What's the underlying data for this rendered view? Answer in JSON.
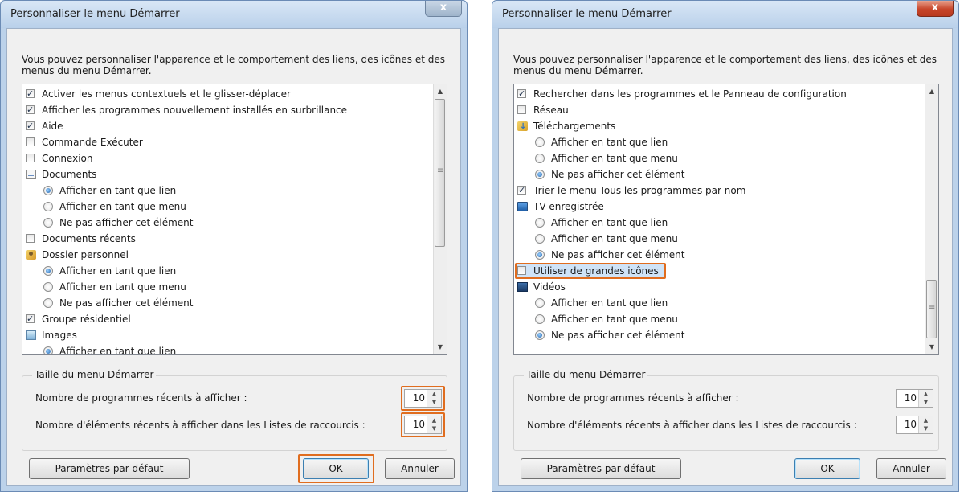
{
  "dialog_left": {
    "title": "Personnaliser le menu Démarrer",
    "close_glyph": "x",
    "description": "Vous pouvez personnaliser l'apparence et le comportement des liens, des icônes et des menus du menu Démarrer.",
    "items": [
      {
        "type": "checkbox",
        "checked": true,
        "label": "Activer les menus contextuels et le glisser-déplacer"
      },
      {
        "type": "checkbox",
        "checked": true,
        "label": "Afficher les programmes nouvellement installés en surbrillance"
      },
      {
        "type": "checkbox",
        "checked": true,
        "label": "Aide"
      },
      {
        "type": "checkbox",
        "checked": false,
        "label": "Commande Exécuter"
      },
      {
        "type": "checkbox",
        "checked": false,
        "label": "Connexion"
      },
      {
        "type": "folder",
        "icon": "document-icon",
        "label": "Documents"
      },
      {
        "type": "radio",
        "checked": true,
        "label": "Afficher en tant que lien"
      },
      {
        "type": "radio",
        "checked": false,
        "label": "Afficher en tant que menu"
      },
      {
        "type": "radio",
        "checked": false,
        "label": "Ne pas afficher cet élément"
      },
      {
        "type": "checkbox",
        "checked": false,
        "label": "Documents récents"
      },
      {
        "type": "folder",
        "icon": "user-folder-icon",
        "label": "Dossier personnel"
      },
      {
        "type": "radio",
        "checked": true,
        "label": "Afficher en tant que lien"
      },
      {
        "type": "radio",
        "checked": false,
        "label": "Afficher en tant que menu"
      },
      {
        "type": "radio",
        "checked": false,
        "label": "Ne pas afficher cet élément"
      },
      {
        "type": "checkbox",
        "checked": true,
        "label": "Groupe résidentiel"
      },
      {
        "type": "folder",
        "icon": "pictures-icon",
        "label": "Images"
      },
      {
        "type": "radio",
        "checked": true,
        "label": "Afficher en tant que lien"
      }
    ],
    "group_title": "Taille du menu Démarrer",
    "recent_programs_label": "Nombre de programmes récents à afficher :",
    "recent_programs_value": "10",
    "jumplist_label": "Nombre d'éléments récents à afficher dans les Listes de raccourcis :",
    "jumplist_value": "10",
    "defaults_button": "Paramètres par défaut",
    "ok_button": "OK",
    "cancel_button": "Annuler"
  },
  "dialog_right": {
    "title": "Personnaliser le menu Démarrer",
    "close_glyph": "x",
    "description": "Vous pouvez personnaliser l'apparence et le comportement des liens, des icônes et des menus du menu Démarrer.",
    "items": [
      {
        "type": "checkbox",
        "checked": true,
        "label": "Rechercher dans les programmes et le Panneau de configuration"
      },
      {
        "type": "checkbox",
        "checked": false,
        "label": "Réseau"
      },
      {
        "type": "folder",
        "icon": "downloads-icon",
        "label": "Téléchargements"
      },
      {
        "type": "radio",
        "checked": false,
        "label": "Afficher en tant que lien"
      },
      {
        "type": "radio",
        "checked": false,
        "label": "Afficher en tant que menu"
      },
      {
        "type": "radio",
        "checked": true,
        "label": "Ne pas afficher cet élément"
      },
      {
        "type": "checkbox",
        "checked": true,
        "label": "Trier le menu Tous les programmes par nom"
      },
      {
        "type": "folder",
        "icon": "tv-icon",
        "label": "TV enregistrée"
      },
      {
        "type": "radio",
        "checked": false,
        "label": "Afficher en tant que lien"
      },
      {
        "type": "radio",
        "checked": false,
        "label": "Afficher en tant que menu"
      },
      {
        "type": "radio",
        "checked": true,
        "label": "Ne pas afficher cet élément"
      },
      {
        "type": "checkbox",
        "checked": false,
        "label": "Utiliser de grandes icônes",
        "highlighted": true
      },
      {
        "type": "folder",
        "icon": "videos-icon",
        "label": "Vidéos"
      },
      {
        "type": "radio",
        "checked": false,
        "label": "Afficher en tant que lien"
      },
      {
        "type": "radio",
        "checked": false,
        "label": "Afficher en tant que menu"
      },
      {
        "type": "radio",
        "checked": true,
        "label": "Ne pas afficher cet élément"
      }
    ],
    "group_title": "Taille du menu Démarrer",
    "recent_programs_label": "Nombre de programmes récents à afficher :",
    "recent_programs_value": "10",
    "jumplist_label": "Nombre d'éléments récents à afficher dans les Listes de raccourcis :",
    "jumplist_value": "10",
    "defaults_button": "Paramètres par défaut",
    "ok_button": "OK",
    "cancel_button": "Annuler"
  },
  "colors": {
    "highlight_outline": "#e06d1f",
    "window_frame": "#bcd2ea",
    "close_button_red": "#c7452a"
  }
}
